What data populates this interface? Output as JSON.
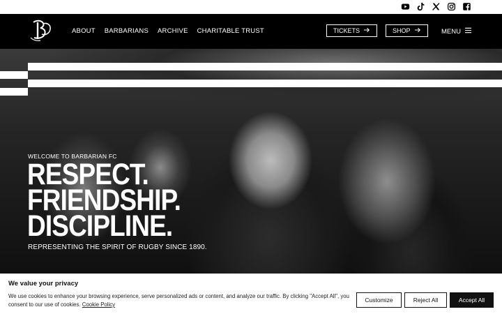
{
  "social": [
    "youtube-icon",
    "tiktok-icon",
    "x-icon",
    "instagram-icon",
    "facebook-icon"
  ],
  "nav": {
    "items": [
      "ABOUT",
      "BARBARIANS",
      "ARCHIVE",
      "CHARITABLE TRUST"
    ],
    "tickets": "TICKETS",
    "shop": "SHOP",
    "menu": "MENU"
  },
  "hero": {
    "welcome": "WELCOME TO BARBARIAN FC",
    "headline": [
      "RESPECT.",
      "FRIENDSHIP.",
      "DISCIPLINE."
    ],
    "tagline": "REPRESENTING THE SPIRIT OF RUGBY SINCE 1890."
  },
  "cookie": {
    "title": "We value your privacy",
    "text": "We use cookies to enhance your browsing experience, serve personalized ads or content, and analyze our traffic. By clicking \"Accept All\", you consent to our use of cookies. ",
    "link": "Cookie Policy",
    "customize": "Customize",
    "reject": "Reject All",
    "accept": "Accept All"
  },
  "colors": {
    "primary": "#000000",
    "background": "#ffffff"
  }
}
